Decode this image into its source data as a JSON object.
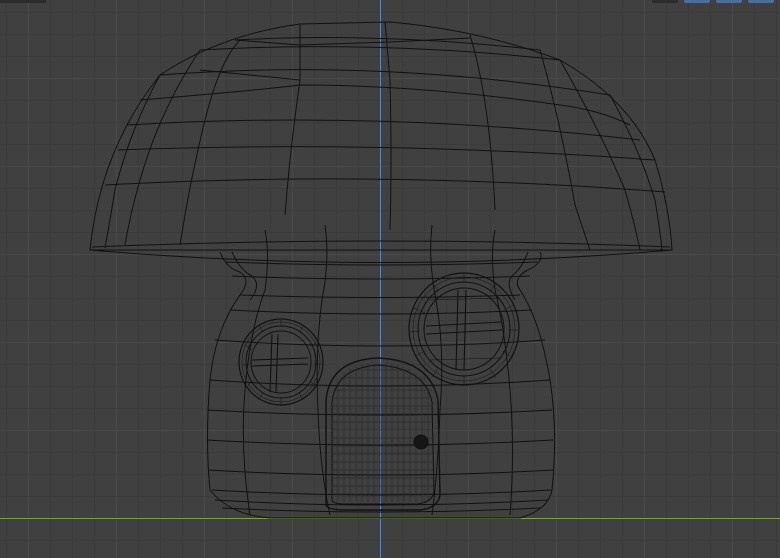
{
  "viewport": {
    "view": "front",
    "shading": "wireframe",
    "object": "mushroom-house"
  },
  "colors": {
    "background": "#404040",
    "grid_major": "#4a4a4a",
    "grid_minor": "#3b3b3b",
    "axis_y": "#5a86bf",
    "axis_x": "#7aa23a",
    "wire": "#101010"
  },
  "toolbar": {
    "icons": [
      "view-options-icon",
      "snap-icon",
      "display-mode-icon",
      "maximize-icon"
    ]
  }
}
